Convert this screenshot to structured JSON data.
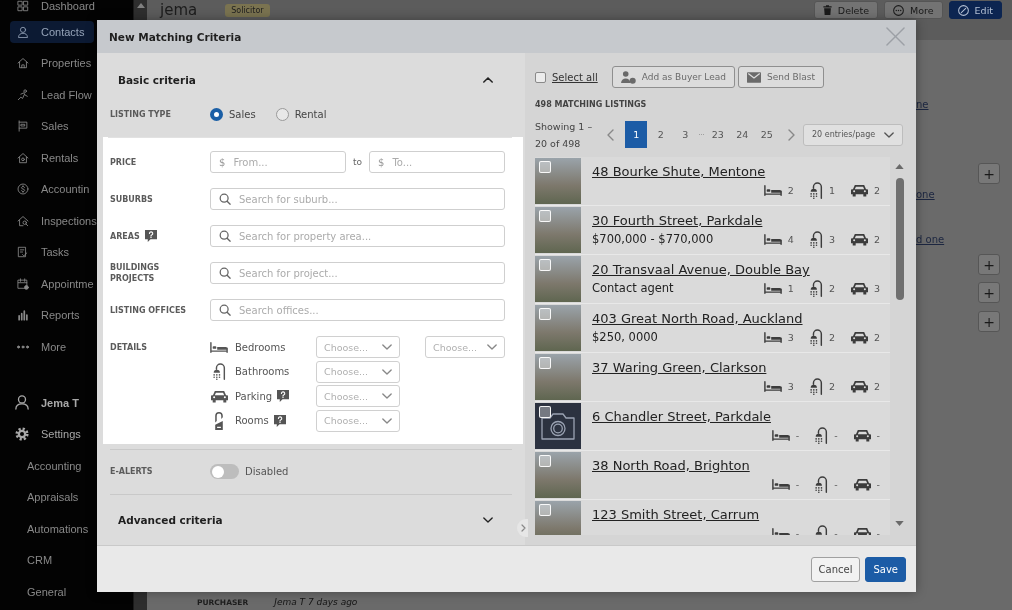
{
  "sidebar": {
    "items": [
      {
        "label": "Dashboard",
        "selected": false
      },
      {
        "label": "Contacts",
        "selected": true
      },
      {
        "label": "Properties",
        "selected": false
      },
      {
        "label": "Lead Flow",
        "selected": false
      },
      {
        "label": "Sales",
        "selected": false
      },
      {
        "label": "Rentals",
        "selected": false
      },
      {
        "label": "Accountin",
        "selected": false
      },
      {
        "label": "Inspections",
        "selected": false
      },
      {
        "label": "Tasks",
        "selected": false
      },
      {
        "label": "Appointme",
        "selected": false
      },
      {
        "label": "Reports",
        "selected": false
      },
      {
        "label": "More",
        "selected": false
      }
    ],
    "user": "Jema T",
    "settings": {
      "label": "Settings",
      "children": [
        "Accounting",
        "Appraisals",
        "Automations",
        "CRM",
        "General"
      ]
    }
  },
  "page": {
    "title": "jema",
    "badge": "Solicitor",
    "actions": [
      {
        "kind": "delete",
        "label": "Delete"
      },
      {
        "kind": "more",
        "label": "More"
      },
      {
        "kind": "edit",
        "label": "Edit"
      }
    ],
    "side_items": [
      {
        "kind": "link",
        "label": "ne"
      },
      {
        "kind": "add",
        "label": "+"
      },
      {
        "kind": "link",
        "label": "one"
      },
      {
        "kind": "link",
        "label": "d one"
      },
      {
        "kind": "add",
        "label": "+"
      },
      {
        "kind": "add",
        "label": "+"
      },
      {
        "kind": "add",
        "label": "+"
      }
    ],
    "footer": {
      "label": "PURCHASER",
      "meta": "Jema T 7 days ago"
    }
  },
  "modal": {
    "title": "New Matching Criteria",
    "basic": {
      "title": "Basic criteria",
      "expanded": true,
      "listing_type": {
        "label": "LISTING TYPE",
        "options": [
          {
            "label": "Sales",
            "selected": true
          },
          {
            "label": "Rental",
            "selected": false
          }
        ]
      },
      "fields": [
        {
          "kind": "range",
          "label": "PRICE",
          "help": false,
          "from": {
            "prefix": "$",
            "placeholder": "From..."
          },
          "separator": "to",
          "to": {
            "prefix": "$",
            "placeholder": "To..."
          }
        },
        {
          "kind": "search",
          "label": "SUBURBS",
          "help": false,
          "placeholder": "Search for suburb..."
        },
        {
          "kind": "search",
          "label": "AREAS",
          "help": true,
          "placeholder": "Search for property area..."
        },
        {
          "kind": "search",
          "label": "BUILDINGS PROJECTS",
          "help": false,
          "placeholder": "Search for project..."
        },
        {
          "kind": "search",
          "label": "LISTING OFFICES",
          "help": false,
          "placeholder": "Search offices..."
        },
        {
          "kind": "details",
          "label": "DETAILS",
          "help": false,
          "rows": [
            {
              "label": "Bedrooms",
              "help": false,
              "selects": [
                "Choose...",
                "Choose..."
              ]
            },
            {
              "label": "Bathrooms",
              "help": false,
              "selects": [
                "Choose..."
              ]
            },
            {
              "label": "Parking",
              "help": true,
              "selects": [
                "Choose..."
              ]
            },
            {
              "label": "Rooms",
              "help": true,
              "selects": [
                "Choose..."
              ]
            }
          ]
        }
      ],
      "e_alerts": {
        "label": "E-ALERTS",
        "on": false,
        "status": "Disabled"
      }
    },
    "advanced": {
      "title": "Advanced criteria",
      "expanded": false
    },
    "results": {
      "select_all": {
        "label": "Select all",
        "checked": false
      },
      "actions": [
        {
          "kind": "buyer",
          "label": "Add as Buyer Lead"
        },
        {
          "kind": "blast",
          "label": "Send Blast"
        }
      ],
      "count": "498 MATCHING LISTINGS",
      "showing": "Showing 1 – 20 of 498",
      "pages": [
        {
          "kind": "page",
          "label": "1",
          "selected": true
        },
        {
          "kind": "page",
          "label": "2",
          "selected": false
        },
        {
          "kind": "page",
          "label": "3",
          "selected": false
        },
        {
          "kind": "gap",
          "label": "···",
          "selected": false
        },
        {
          "kind": "page",
          "label": "23",
          "selected": false
        },
        {
          "kind": "page",
          "label": "24",
          "selected": false
        },
        {
          "kind": "page",
          "label": "25",
          "selected": false
        }
      ],
      "per_page": "20 entries/page",
      "listings": [
        {
          "kind": "photo",
          "checked": false,
          "title": "48 Bourke Shute, Mentone",
          "beds": "2",
          "baths": "1",
          "cars": "2"
        },
        {
          "kind": "photo",
          "checked": false,
          "title": "30 Fourth Street, Parkdale",
          "price": "$700,000 - $770,000",
          "beds": "4",
          "baths": "3",
          "cars": "2"
        },
        {
          "kind": "photo",
          "checked": false,
          "title": "20 Transvaal Avenue, Double Bay",
          "price": "Contact agent",
          "beds": "1",
          "baths": "2",
          "cars": "3"
        },
        {
          "kind": "photo",
          "checked": false,
          "title": "403 Great North Road, Auckland",
          "price": "$250, 0000",
          "beds": "3",
          "baths": "2",
          "cars": "2"
        },
        {
          "kind": "photo",
          "checked": false,
          "title": "37 Waring Green, Clarkson",
          "beds": "3",
          "baths": "2",
          "cars": "2"
        },
        {
          "kind": "no_photo",
          "checked": false,
          "title": "6 Chandler Street, Parkdale",
          "beds": "-",
          "baths": "-",
          "cars": "-"
        },
        {
          "kind": "photo",
          "checked": false,
          "title": "38 North Road, Brighton",
          "beds": "-",
          "baths": "-",
          "cars": "-"
        },
        {
          "kind": "photo",
          "checked": false,
          "title": "123 Smith Street, Carrum",
          "beds": "-",
          "baths": "-",
          "cars": "-"
        }
      ]
    },
    "buttons": [
      {
        "kind": "secondary",
        "label": "Cancel"
      },
      {
        "kind": "primary",
        "label": "Save"
      }
    ]
  }
}
